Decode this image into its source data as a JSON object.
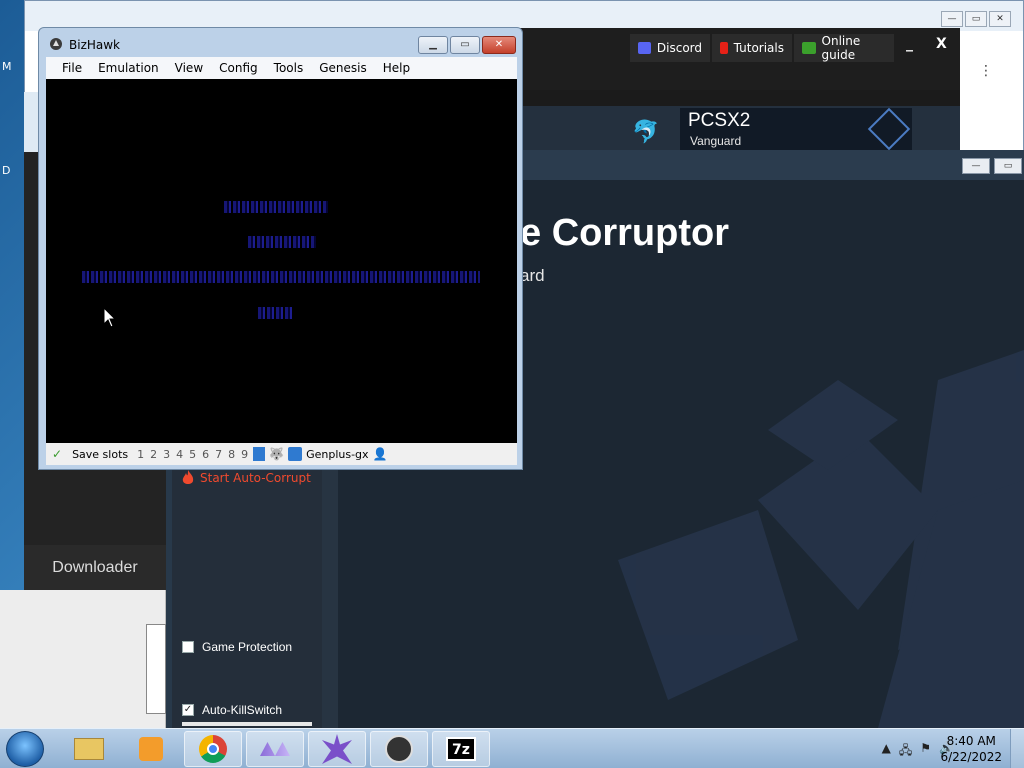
{
  "desktop": {
    "letters": [
      "M",
      "D"
    ]
  },
  "browser": {
    "kebab": "⋮",
    "caption": [
      "—",
      "▭",
      "✕"
    ]
  },
  "launcher": {
    "buttons": [
      {
        "label": "Discord",
        "color": "#5865f2",
        "icon": "discord-icon"
      },
      {
        "label": "Tutorials",
        "color": "#e62117",
        "icon": "youtube-icon"
      },
      {
        "label": "Online guide",
        "color": "#3ba02c",
        "icon": "guide-icon"
      }
    ],
    "minimize": "_",
    "close": "X",
    "pcsx2_title": "PCSX2",
    "pcsx2_subtitle": "Vanguard"
  },
  "downloader": {
    "label": "Downloader"
  },
  "rtc": {
    "title": "e Corruptor",
    "subtitle": "ard",
    "start_auto_corrupt": "Start Auto-Corrupt",
    "game_protection": {
      "label": "Game Protection",
      "checked": false
    },
    "auto_killswitch": {
      "label": "Auto-KillSwitch",
      "checked": true
    }
  },
  "bizhawk": {
    "title": "BizHawk",
    "menu": [
      "File",
      "Emulation",
      "View",
      "Config",
      "Tools",
      "Genesis",
      "Help"
    ],
    "status": {
      "save_slots_label": "Save slots",
      "slots": [
        "1",
        "2",
        "3",
        "4",
        "5",
        "6",
        "7",
        "8",
        "9",
        "0"
      ],
      "active_slot": "0",
      "core": "Genplus-gx"
    }
  },
  "taskbar": {
    "items": [
      {
        "name": "explorer-icon",
        "active": false
      },
      {
        "name": "media-player-icon",
        "active": false
      },
      {
        "name": "chrome-icon",
        "active": true
      },
      {
        "name": "rtc-launcher-icon",
        "active": true
      },
      {
        "name": "rtc-corruptor-icon",
        "active": true
      },
      {
        "name": "bizhawk-icon",
        "active": true
      },
      {
        "name": "7zip-icon",
        "active": true
      }
    ],
    "time": "8:40 AM",
    "date": "6/22/2022"
  }
}
